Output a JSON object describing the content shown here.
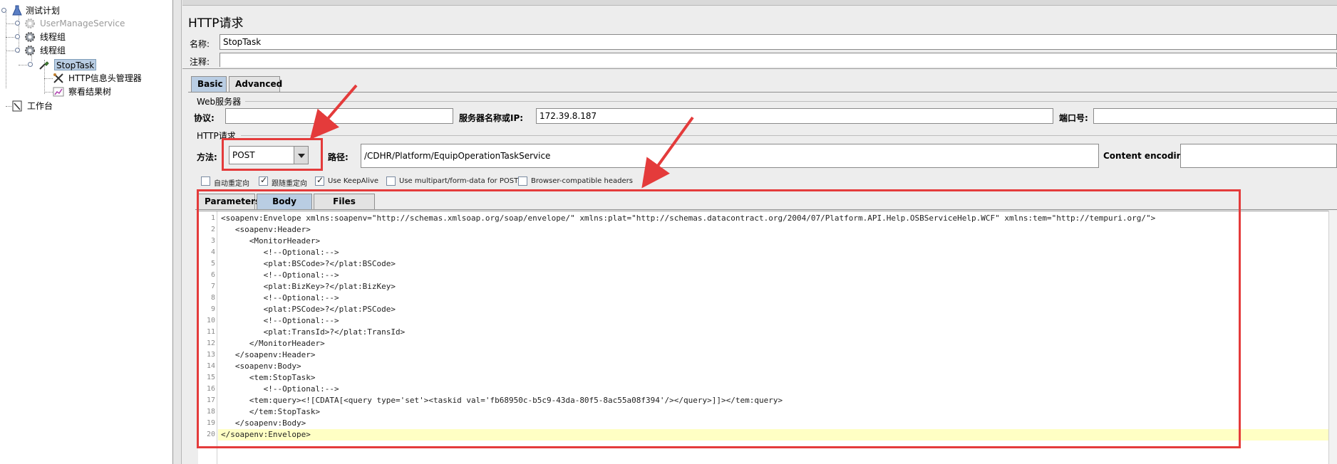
{
  "tree": {
    "root": "测试计划",
    "items": [
      {
        "label": "UserManageService",
        "disabled": true
      },
      {
        "label": "线程组",
        "disabled": false
      },
      {
        "label": "线程组",
        "disabled": false
      },
      {
        "label": "StopTask",
        "selected": true
      },
      {
        "label": "HTTP信息头管理器"
      },
      {
        "label": "察看结果树"
      }
    ],
    "workbench": "工作台"
  },
  "panel": {
    "title": "HTTP请求",
    "name_label": "名称:",
    "name_value": "StopTask",
    "comment_label": "注释:",
    "tabs": [
      "Basic",
      "Advanced"
    ],
    "web_server_group": "Web服务器",
    "protocol_label": "协议:",
    "protocol_value": "",
    "server_label": "服务器名称或IP:",
    "server_value": "172.39.8.187",
    "port_label": "端口号:",
    "port_value": "",
    "http_group": "HTTP请求",
    "method_label": "方法:",
    "method_value": "POST",
    "path_label": "路径:",
    "path_value": "/CDHR/Platform/EquipOperationTaskService",
    "encoding_label": "Content encoding:",
    "encoding_value": "",
    "checkboxes": [
      {
        "label": "自动重定向",
        "checked": false
      },
      {
        "label": "跟随重定向",
        "checked": true
      },
      {
        "label": "Use KeepAlive",
        "checked": true
      },
      {
        "label": "Use multipart/form-data for POST",
        "checked": false
      },
      {
        "label": "Browser-compatible headers",
        "checked": false
      }
    ],
    "body_tabs": [
      "Parameters",
      "Body Data",
      "Files Upload"
    ]
  },
  "editor": {
    "lines": [
      {
        "n": "1",
        "text": "<soapenv:Envelope xmlns:soapenv=\"http://schemas.xmlsoap.org/soap/envelope/\" xmlns:plat=\"http://schemas.datacontract.org/2004/07/Platform.API.Help.OSBServiceHelp.WCF\" xmlns:tem=\"http://tempuri.org/\">"
      },
      {
        "n": "2",
        "text": "   <soapenv:Header>"
      },
      {
        "n": "3",
        "text": "      <MonitorHeader>"
      },
      {
        "n": "4",
        "text": "         <!--Optional:-->"
      },
      {
        "n": "5",
        "text": "         <plat:BSCode>?</plat:BSCode>"
      },
      {
        "n": "6",
        "text": "         <!--Optional:-->"
      },
      {
        "n": "7",
        "text": "         <plat:BizKey>?</plat:BizKey>"
      },
      {
        "n": "8",
        "text": "         <!--Optional:-->"
      },
      {
        "n": "9",
        "text": "         <plat:PSCode>?</plat:PSCode>"
      },
      {
        "n": "10",
        "text": "         <!--Optional:-->"
      },
      {
        "n": "11",
        "text": "         <plat:TransId>?</plat:TransId>"
      },
      {
        "n": "12",
        "text": "      </MonitorHeader>"
      },
      {
        "n": "13",
        "text": "   </soapenv:Header>"
      },
      {
        "n": "14",
        "text": "   <soapenv:Body>"
      },
      {
        "n": "15",
        "text": "      <tem:StopTask>"
      },
      {
        "n": "16",
        "text": "         <!--Optional:-->"
      },
      {
        "n": "17",
        "text": "      <tem:query><![CDATA[<query type='set'><taskid val='fb68950c-b5c9-43da-80f5-8ac55a08f394'/></query>]]></tem:query>"
      },
      {
        "n": "18",
        "text": "      </tem:StopTask>"
      },
      {
        "n": "19",
        "text": "   </soapenv:Body>"
      },
      {
        "n": "20",
        "text": "</soapenv:Envelope>"
      }
    ]
  },
  "colors": {
    "annotation": "#e43b3b",
    "tab_active": "#b9cde3",
    "current_line": "#ffffc4"
  }
}
